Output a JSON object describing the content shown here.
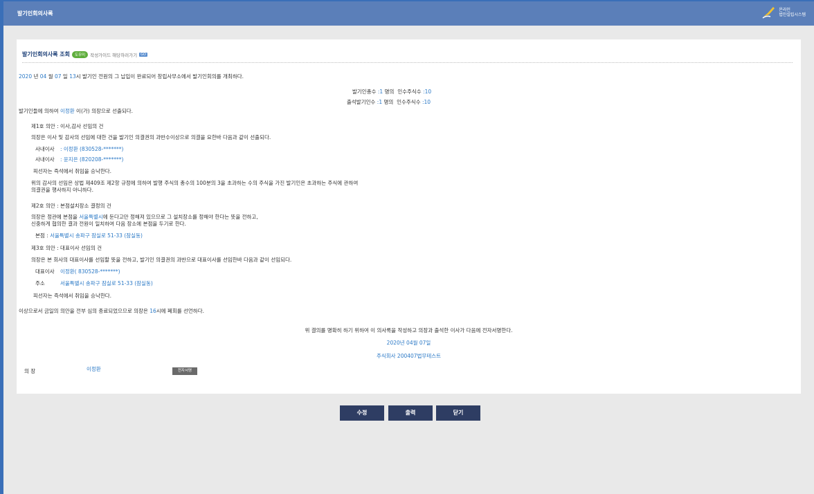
{
  "header": {
    "title": "발기인회의사록",
    "logo_line1": "온라인",
    "logo_line2": "법인설립시스템"
  },
  "heading": {
    "title": "발기인회의사록 조회",
    "badge": "도우미",
    "guide": "작성가이드 해당하러가기",
    "go": "GO"
  },
  "intro": {
    "year": "2020",
    "y": " 년 ",
    "month": "04",
    "m": " 월 ",
    "day": "07",
    "d": " 일 ",
    "hour": "13",
    "rest": "시 발기인 전원의 그 납입이 완료되어 창립사무소에서 발기인회의를 개최하다."
  },
  "summary": {
    "total_label": "발기인총수",
    "total_value": ":1",
    "total_unit": "명의",
    "shares_label": "인수주식수",
    "shares_value": ":10",
    "attend_label": "출석발기인수",
    "attend_value": ":1",
    "attend_unit": "명의",
    "attend_shares_label": "인수주식수",
    "attend_shares_value": ":10"
  },
  "chair": {
    "prefix": "발기인들에 의하여 ",
    "name": "이정환",
    "suffix": " 이(가) 의장으로 선출되다."
  },
  "agenda1": {
    "title": "제1호 의안 : 이사,감사 선임의 건",
    "desc": "의장은 이사 및 감사의 선임에 대한 건을 발기인 의결권의 과반수이상으로 의결을 요한바 다음과 같이 선출되다.",
    "rows": [
      {
        "role": "사내이사",
        "value": ": 이정환   (830528-*******)"
      },
      {
        "role": "사내이사",
        "value": ": 윤지은   (820208-*******)"
      }
    ],
    "accept": "피선자는 즉석에서 취임을 승낙한다.",
    "note1": "위의 감사의 선임은 상법 제409조 제2항 규정에 의하여 발행 주식의 총수의 100분의 3을 초과하는 수의 주식을 가진 발기인은 초과하는 주식에 관하여",
    "note2": "의결권을 행사하지 아니하다."
  },
  "agenda2": {
    "title": "제2호 의안 : 본점설치장소 결정의 건",
    "desc1_a": "의장은 정관에 본점을 ",
    "desc1_city": "서울특별시",
    "desc1_b": "에 둔다고만 정해져 있으므로 그 설치장소를 정해야 한다는 뜻을 전하고,",
    "desc2": "신중하게 협의한 결과 전원이 일치하여 다음 장소에 본점을 두기로 한다.",
    "hq_label": "본점 : ",
    "hq_value": "서울특별시 송파구 잠실로 51-33 (잠실동)"
  },
  "agenda3": {
    "title": "제3호 의안 : 대표이사 선임의 건",
    "desc": "의장은 본 회사의 대표이사를 선임할 뜻을 전하고, 발기인 의결권의 과반으로 대표이사를 선임한바 다음과 같이 선임되다.",
    "ceo_label": "대표이사",
    "ceo_value": "이정환( 830528-*******)",
    "addr_label": "주소",
    "addr_value": "서울특별시 송파구 잠실로 51-33 (잠실동)",
    "accept": "피선자는 즉석에서 취임을 승낙한다."
  },
  "closing": {
    "a": "이상으로서 금일의 의안을 전부 심의 종료되었으므로 의장은 ",
    "hour": "16",
    "b": "시에 폐회를 선언하다."
  },
  "sign": {
    "statement": "위 결의를 명확히 하기 위하여 이 의사록을 작성하고 의장과 출석한 이사가 다음에 전자서명한다.",
    "date": "2020년 04월 07일",
    "company": "주식회사 200407법무테스트",
    "chair_label": "의 장",
    "chair_name": "이정환",
    "esign": "전자서명"
  },
  "buttons": {
    "edit": "수정",
    "print": "출력",
    "close": "닫기"
  },
  "colors": {
    "header": "#5b7fb9",
    "frame": "#3a6fb8",
    "link": "#2a78c6",
    "button": "#2e3d63"
  }
}
